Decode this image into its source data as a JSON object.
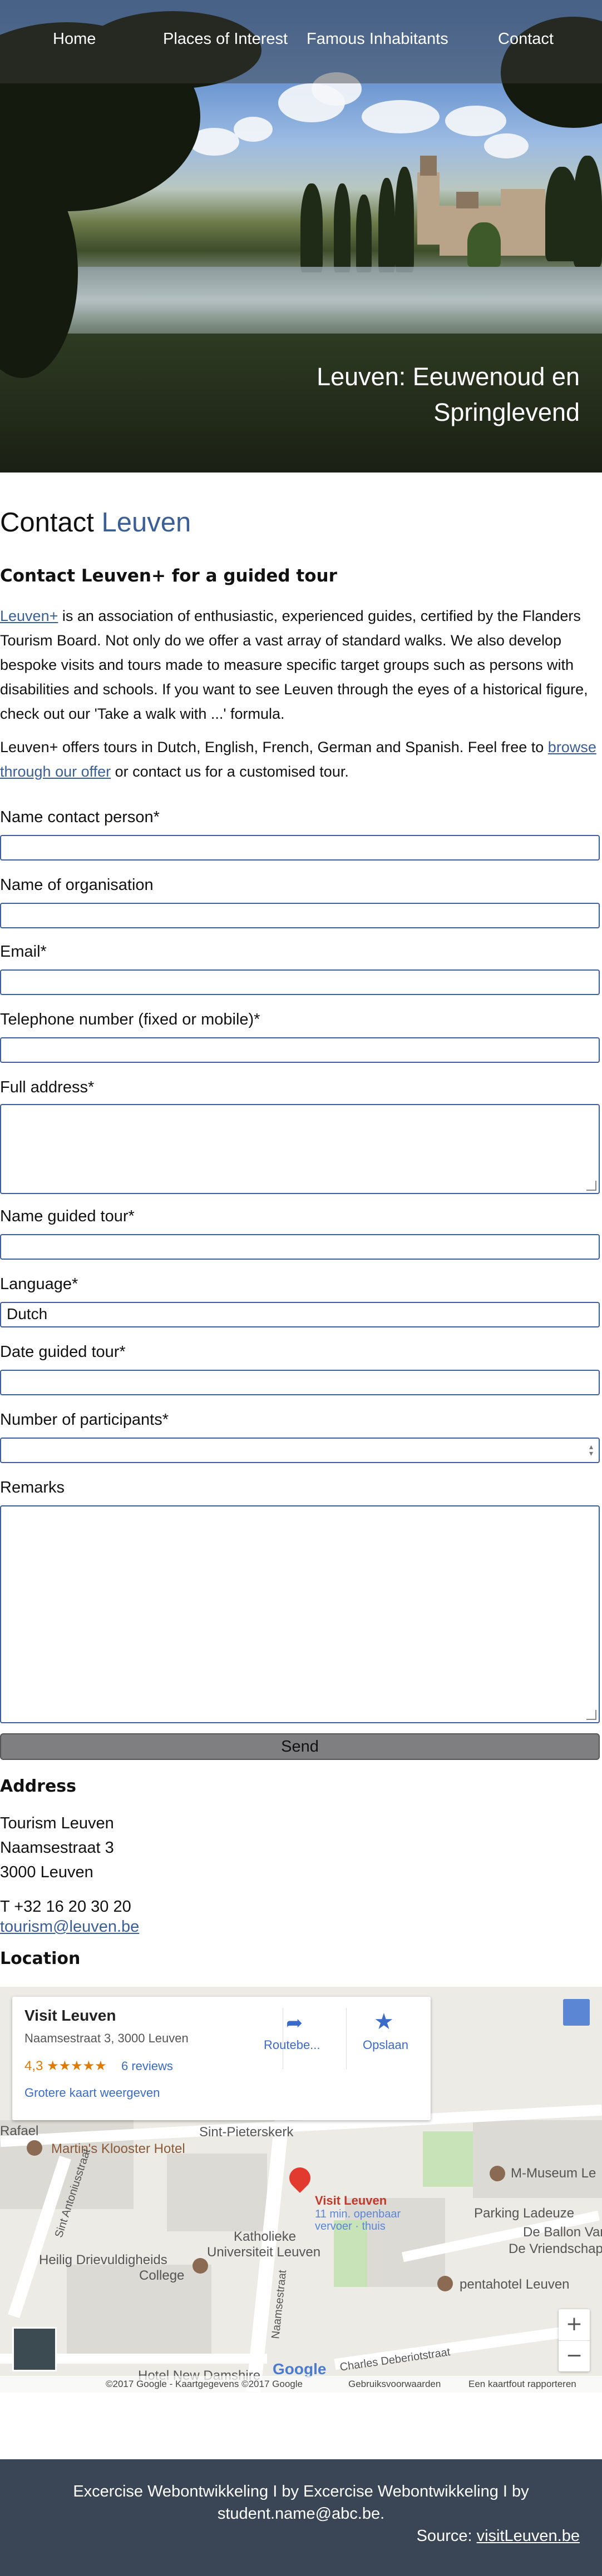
{
  "nav": {
    "items": [
      "Home",
      "Places of Interest",
      "Famous Inhabitants",
      "Contact"
    ]
  },
  "hero": {
    "title_line1": "Leuven: Eeuwenoud en",
    "title_line2": "Springlevend"
  },
  "page_title": {
    "word1": "Contact",
    "word2": "Leuven"
  },
  "intro": {
    "heading": "Contact Leuven+ for a guided tour",
    "link1": "Leuven+",
    "p1_rest": " is an association of enthusiastic, experienced guides, certified by the Flanders Tourism Board. Not only do we offer a vast array of standard walks. We also develop bespoke visits and tours made to measure specific target groups such as persons with disabilities and schools. If you want to see Leuven through the eyes of a historical figure, check out our 'Take a walk with ...' formula.",
    "p2_start": "Leuven+ offers tours in Dutch, English, French, German and Spanish. Feel free to ",
    "p2_link": "browse through our offer",
    "p2_end": " or contact us for a customised tour."
  },
  "form": {
    "name_label": "Name contact person*",
    "org_label": "Name of organisation",
    "email_label": "Email*",
    "phone_label": "Telephone number (fixed or mobile)*",
    "address_label": "Full address*",
    "tour_label": "Name guided tour*",
    "language_label": "Language*",
    "language_value": "Dutch",
    "date_label": "Date guided tour*",
    "participants_label": "Number of participants*",
    "remarks_label": "Remarks",
    "send_label": "Send"
  },
  "address": {
    "heading": "Address",
    "line1": "Tourism Leuven",
    "line2": "Naamsestraat 3",
    "line3": "3000 Leuven",
    "phone": "T +32 16 20 30 20",
    "email": "tourism@leuven.be"
  },
  "location": {
    "heading": "Location"
  },
  "map": {
    "card_title": "Visit Leuven",
    "card_address": "Naamsestraat 3, 3000 Leuven",
    "rating": "4,3",
    "stars": "★★★★★",
    "reviews": "6 reviews",
    "larger_map": "Grotere kaart weergeven",
    "route_label": "Routebe...",
    "save_label": "Opslaan",
    "pin_label": "Visit Leuven",
    "pin_sub1": "11 min. openbaar",
    "pin_sub2": "vervoer · thuis",
    "labels": {
      "rafael": "Rafael",
      "pieterskerk": "Sint-Pieterskerk",
      "martins": "Martin's Klooster Hotel",
      "museum": "M-Museum Le",
      "parking": "Parking Ladeuze",
      "ballon1": "De Ballon Van",
      "ballon2": "De Vriendschap",
      "kul1": "Katholieke",
      "kul2": "Universiteit Leuven",
      "heilig1": "Heilig Drievuldigheids",
      "heilig2": "College",
      "penta": "pentahotel Leuven",
      "damshire": "Hotel New Damshire",
      "antoniusstraat": "Sint Antoniusstraat",
      "naamsestraat": "Naamsestraat",
      "deberiot": "Charles Deberiotstraat",
      "google": "Google",
      "copyright": "©2017 Google - Kaartgegevens ©2017 Google",
      "terms": "Gebruiksvoorwaarden",
      "report": "Een kaartfout rapporteren"
    },
    "zoom_in": "+",
    "zoom_out": "−"
  },
  "footer": {
    "line1": "Excercise Webontwikkeling I by Excercise Webontwikkeling I by",
    "line2": "student.name@abc.be.",
    "source_label": "Source: ",
    "source_link": "visitLeuven.be"
  }
}
